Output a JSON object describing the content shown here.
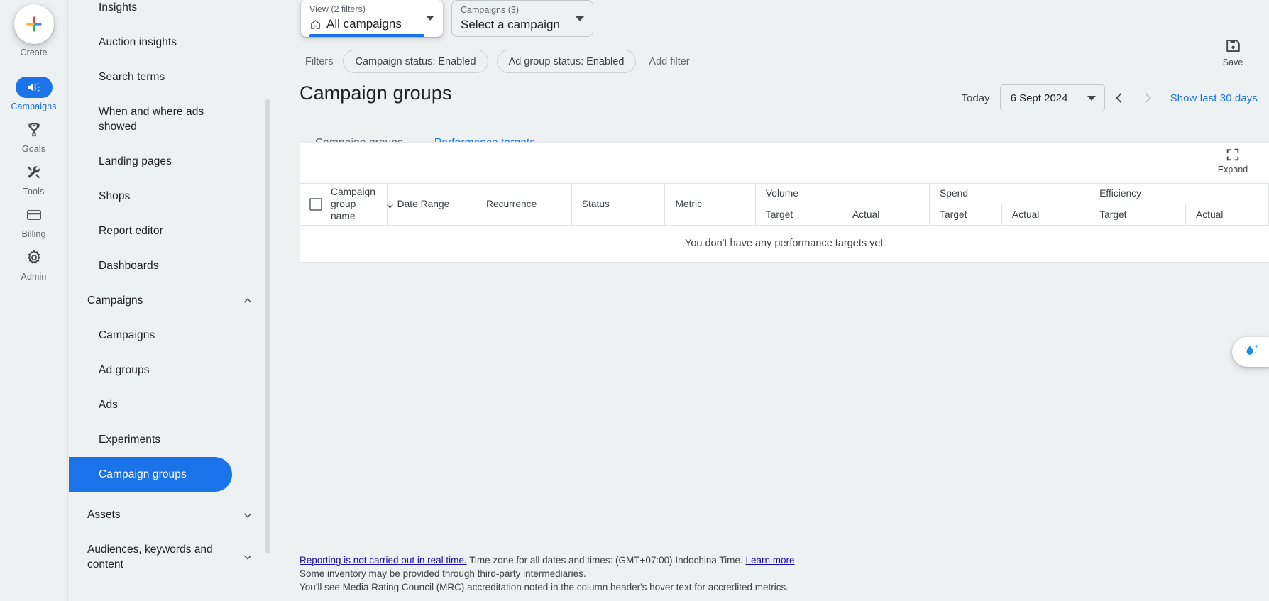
{
  "rail": {
    "create": {
      "label": "Create",
      "icon": "plus-icon"
    },
    "items": [
      {
        "label": "Campaigns",
        "icon": "megaphone-icon",
        "active": true
      },
      {
        "label": "Goals",
        "icon": "trophy-icon",
        "active": false
      },
      {
        "label": "Tools",
        "icon": "tools-icon",
        "active": false
      },
      {
        "label": "Billing",
        "icon": "credit-card-icon",
        "active": false
      },
      {
        "label": "Admin",
        "icon": "gear-icon",
        "active": false
      }
    ]
  },
  "pagenav": {
    "top_links": [
      "Insights",
      "Auction insights",
      "Search terms",
      "When and where ads showed",
      "Landing pages",
      "Shops",
      "Report editor",
      "Dashboards"
    ],
    "sections": [
      {
        "label": "Campaigns",
        "expanded": true,
        "items": [
          "Campaigns",
          "Ad groups",
          "Ads",
          "Experiments",
          "Campaign groups"
        ],
        "selected": "Campaign groups"
      },
      {
        "label": "Assets",
        "expanded": false,
        "items": []
      },
      {
        "label": "Audiences, keywords and content",
        "expanded": false,
        "items": []
      }
    ]
  },
  "toolbar": {
    "view_selector": {
      "top_label": "View (2 filters)",
      "value": "All campaigns",
      "icon": "home-icon"
    },
    "campaign_selector": {
      "top_label": "Campaigns (3)",
      "value": "Select a campaign"
    },
    "filters_label": "Filters",
    "filter_chips": [
      "Campaign status: Enabled",
      "Ad group status: Enabled"
    ],
    "add_filter_label": "Add filter",
    "save": {
      "label": "Save",
      "icon": "save-disk-icon"
    }
  },
  "page": {
    "title": "Campaign groups",
    "today_label": "Today",
    "date_value": "6 Sept 2024",
    "prev_icon": "chevron-left-icon",
    "next_icon": "chevron-right-icon",
    "show_last_30": "Show last 30 days",
    "tabs": [
      {
        "label": "Campaign groups",
        "active": false
      },
      {
        "label": "Performance targets",
        "active": true
      }
    ]
  },
  "card": {
    "expand": {
      "label": "Expand",
      "icon": "expand-icon"
    },
    "columns": [
      {
        "label": "Campaign group name",
        "sort": "desc",
        "sort_icon": "arrow-down-icon"
      },
      {
        "label": "Date Range"
      },
      {
        "label": "Recurrence"
      },
      {
        "label": "Status"
      },
      {
        "label": "Metric"
      }
    ],
    "column_groups": [
      {
        "label": "Volume",
        "sub": [
          "Target",
          "Actual"
        ]
      },
      {
        "label": "Spend",
        "sub": [
          "Target",
          "Actual"
        ]
      },
      {
        "label": "Efficiency",
        "sub": [
          "Target",
          "Actual"
        ]
      }
    ],
    "empty_message": "You don't have any performance targets yet",
    "rows": []
  },
  "footer": {
    "line1_link": "Reporting is not carried out in real time.",
    "line1_text": " Time zone for all dates and times: (GMT+07:00) Indochina Time. ",
    "line1_link2": "Learn more",
    "line2": "Some inventory may be provided through third-party intermediaries.",
    "line3": "You'll see Media Rating Council (MRC) accreditation noted in the column header's hover text for accredited metrics."
  },
  "ai_widget": {
    "icon": "ai-sparkle-drop-icon"
  },
  "colors": {
    "accent": "#1a73e8",
    "page_bg": "#eef1f2",
    "card_bg": "#ffffff",
    "text_primary": "#1f1f1f",
    "text_secondary": "#5f6368",
    "link": "#1a0dab",
    "border": "#e0e3e4"
  }
}
